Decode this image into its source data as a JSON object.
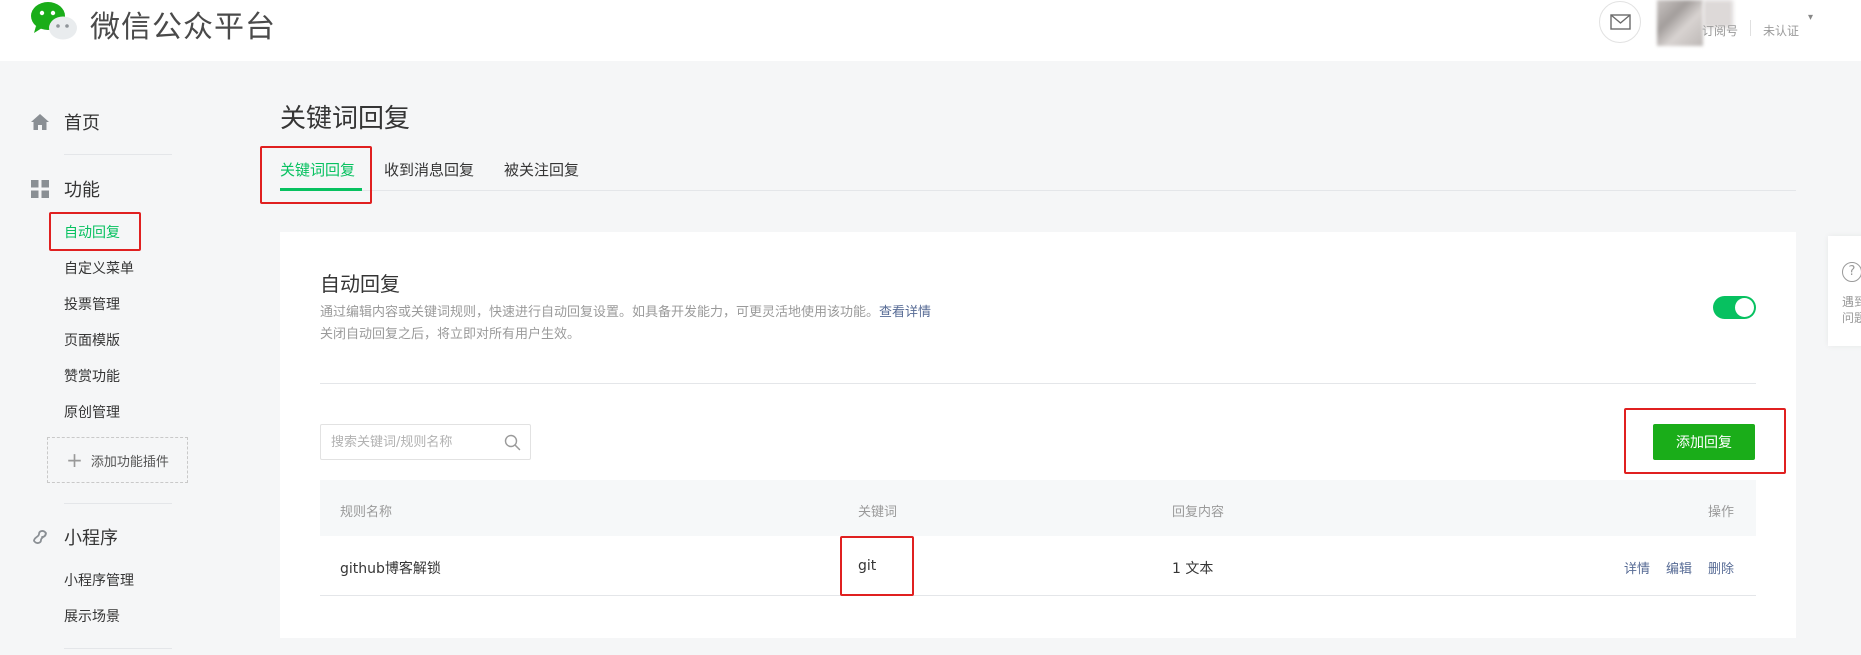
{
  "header": {
    "brand": "微信公众平台",
    "account_type": "订阅号",
    "account_status": "未认证",
    "caret": "▾"
  },
  "sidebar": {
    "home": "首页",
    "features": "功能",
    "feature_items": [
      "自动回复",
      "自定义菜单",
      "投票管理",
      "页面模版",
      "赞赏功能",
      "原创管理"
    ],
    "add_plugin": "添加功能插件",
    "plugin_plus": "+",
    "miniprogram": "小程序",
    "miniprogram_items": [
      "小程序管理",
      "展示场景"
    ]
  },
  "main": {
    "title": "关键词回复",
    "tabs": [
      "关键词回复",
      "收到消息回复",
      "被关注回复"
    ],
    "card": {
      "title": "自动回复",
      "desc_line1": "通过编辑内容或关键词规则，快速进行自动回复设置。如具备开发能力，可更灵活地使用该功能。",
      "desc_link": "查看详情",
      "desc_line2": "关闭自动回复之后，将立即对所有用户生效。",
      "toggle_on": true
    },
    "search_placeholder": "搜索关键词/规则名称",
    "add_button": "添加回复",
    "table": {
      "headers": [
        "规则名称",
        "关键词",
        "回复内容",
        "操作"
      ],
      "rows": [
        {
          "name": "github博客解锁",
          "keyword": "git",
          "content": "1 文本",
          "ops": [
            "详情",
            "编辑",
            "删除"
          ]
        }
      ]
    }
  },
  "help_float": {
    "q": "?",
    "text_line1": "遇到",
    "text_line2": "问题"
  },
  "colors": {
    "accent": "#07c160",
    "button": "#1aad19",
    "link": "#576b95",
    "annotation": "#e02020"
  }
}
